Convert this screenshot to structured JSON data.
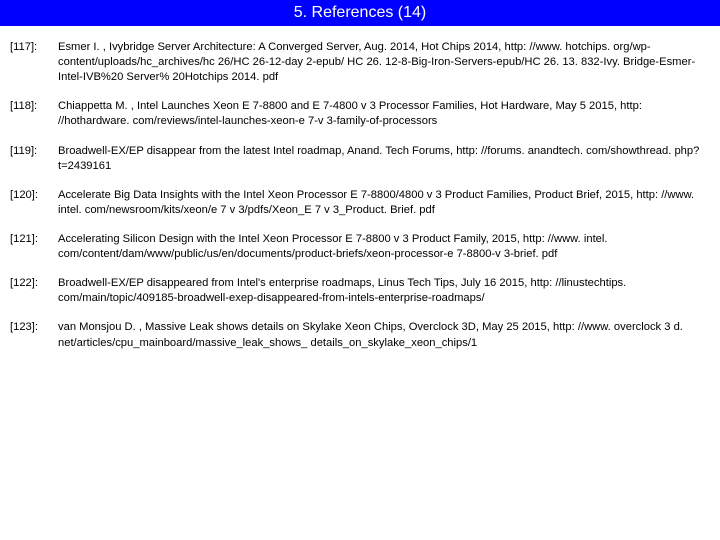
{
  "header": {
    "title": "5. References (14)"
  },
  "references": [
    {
      "label": "[117]:",
      "text": "Esmer I. , Ivybridge Server Architecture: A Converged Server, Aug. 2014, Hot Chips 2014, http: //www. hotchips. org/wp-content/uploads/hc_archives/hc 26/HC 26-12-day 2-epub/ HC 26. 12-8-Big-Iron-Servers-epub/HC 26. 13. 832-Ivy. Bridge-Esmer-Intel-IVB%20 Server% 20Hotchips 2014. pdf"
    },
    {
      "label": "[118]:",
      "text": "Chiappetta M. , Intel Launches Xeon E 7-8800 and E 7-4800 v 3 Processor Families, Hot Hardware, May 5 2015, http: //hothardware. com/reviews/intel-launches-xeon-e 7-v 3-family-of-processors"
    },
    {
      "label": "[119]:",
      "text": "Broadwell-EX/EP disappear from the latest Intel roadmap, Anand. Tech Forums, http: //forums. anandtech. com/showthread. php? t=2439161"
    },
    {
      "label": "[120]:",
      "text": "Accelerate Big Data Insights with the Intel Xeon Processor E 7-8800/4800 v 3 Product Families, Product Brief, 2015, http: //www. intel. com/newsroom/kits/xeon/e 7 v 3/pdfs/Xeon_E 7 v 3_Product. Brief. pdf"
    },
    {
      "label": "[121]:",
      "text": "Accelerating Silicon Design with the Intel Xeon Processor E 7-8800 v 3 Product Family, 2015, http: //www. intel. com/content/dam/www/public/us/en/documents/product-briefs/xeon-processor-e 7-8800-v 3-brief. pdf"
    },
    {
      "label": "[122]:",
      "text": "Broadwell-EX/EP disappeared from Intel's enterprise roadmaps, Linus Tech Tips, July 16 2015, http: //linustechtips. com/main/topic/409185-broadwell-exep-disappeared-from-intels-enterprise-roadmaps/"
    },
    {
      "label": "[123]:",
      "text": "van Monsjou D. , Massive Leak shows details on Skylake Xeon Chips, Overclock 3D, May 25 2015, http: //www. overclock 3 d. net/articles/cpu_mainboard/massive_leak_shows_ details_on_skylake_xeon_chips/1"
    }
  ]
}
